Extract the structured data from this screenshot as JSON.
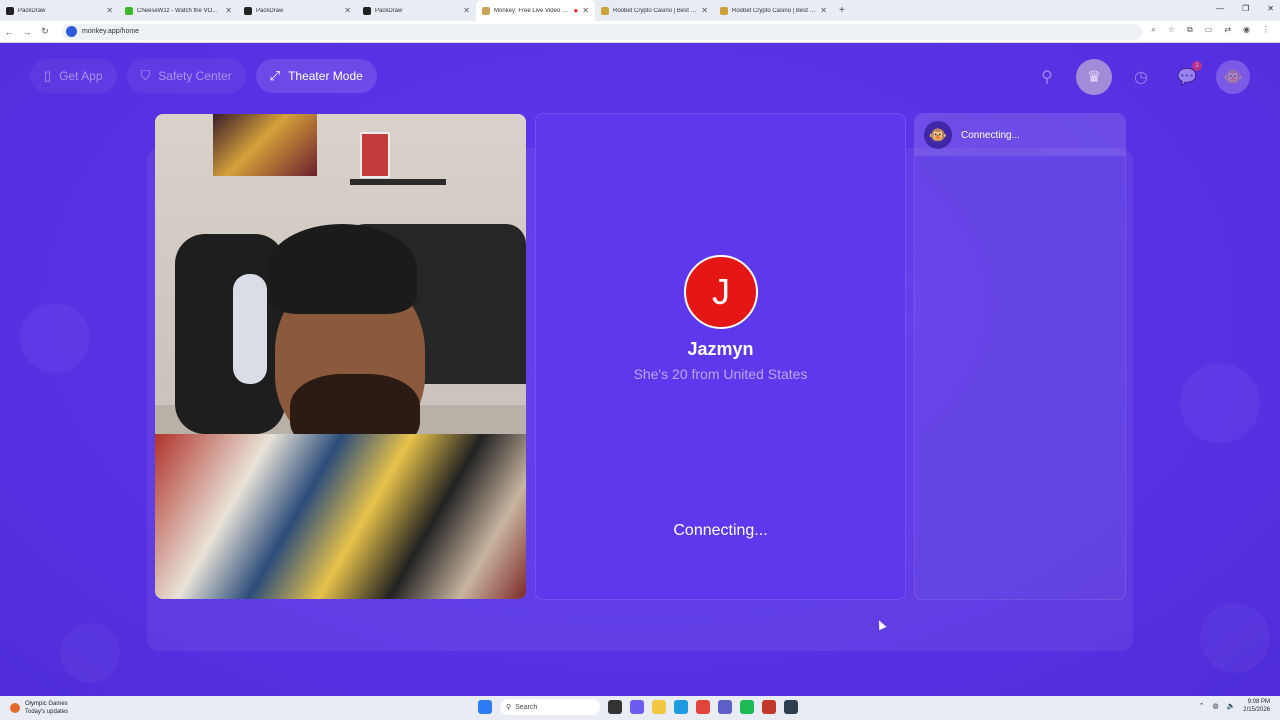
{
  "browser": {
    "tabs": [
      {
        "title": "PackDraw",
        "color": "#222222",
        "active": false
      },
      {
        "title": "CheeseW1z - Watch the VOD o...",
        "color": "#3db82e",
        "active": false
      },
      {
        "title": "PackDraw",
        "color": "#222222",
        "active": false
      },
      {
        "title": "PackDraw",
        "color": "#222222",
        "active": false
      },
      {
        "title": "Monkey: Free Live Video Ch...",
        "color": "#caa35b",
        "active": true
      },
      {
        "title": "Roobet Crypto Casino | Best Bit...",
        "color": "#c9a23a",
        "active": false
      },
      {
        "title": "Roobet Crypto Casino | Best Bit...",
        "color": "#c9a23a",
        "active": false
      }
    ],
    "new_tab": "+",
    "url": "monkey.app/home"
  },
  "app": {
    "nav": {
      "get_app": "Get App",
      "safety_center": "Safety Center",
      "theater_mode": "Theater Mode"
    },
    "notifications_badge": "1",
    "match": {
      "initial": "J",
      "name": "Jazmyn",
      "description": "She's 20 from United States",
      "status": "Connecting..."
    },
    "chat": {
      "status": "Connecting..."
    }
  },
  "taskbar": {
    "weather_title": "Olympic Games",
    "weather_sub": "Today's updates",
    "search": "Search",
    "time": "9:08 PM",
    "date": "2/15/2026"
  },
  "colors": {
    "brand": "#5b34e6",
    "avatar": "#e51616"
  }
}
